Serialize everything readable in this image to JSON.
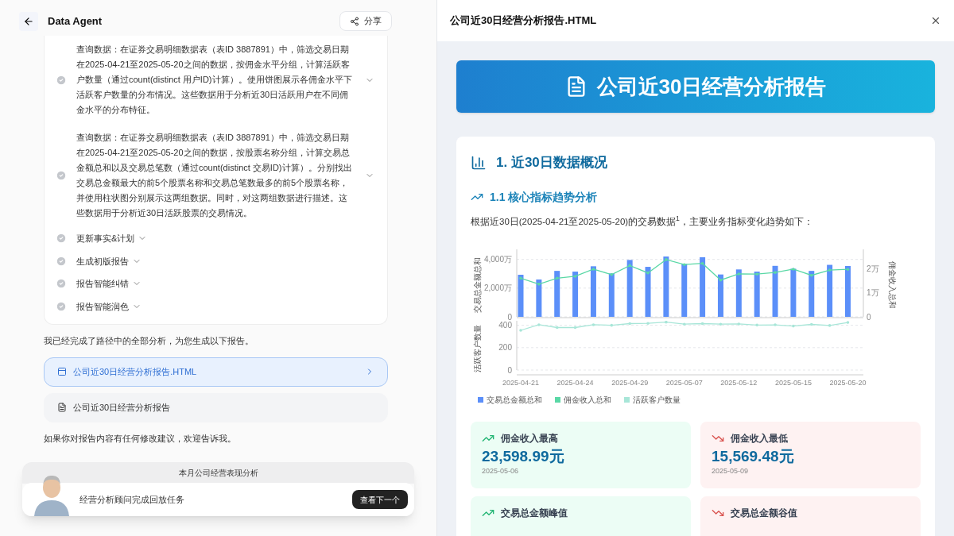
{
  "header": {
    "title": "Data Agent",
    "share": "分享"
  },
  "steps": [
    {
      "text": "查询数据：在证券交易明细数据表（表ID 3887891）中，筛选交易日期在2025-04-21至2025-05-20之间的数据，按佣金水平分组，计算活跃客户数量（通过count(distinct 用户ID)计算）。使用饼图展示各佣金水平下活跃客户数量的分布情况。这些数据用于分析近30日活跃用户在不同佣金水平的分布特征。",
      "kind": "long"
    },
    {
      "text": "查询数据：在证券交易明细数据表（表ID 3887891）中，筛选交易日期在2025-04-21至2025-05-20之间的数据，按股票名称分组，计算交易总金额总和以及交易总笔数（通过count(distinct 交易ID)计算）。分别找出交易总金额最大的前5个股票名称和交易总笔数最多的前5个股票名称，并使用柱状图分别展示这两组数据。同时，对这两组数据进行描述。这些数据用于分析近30日活跃股票的交易情况。",
      "kind": "long"
    },
    {
      "text": "更新事实&计划",
      "kind": "short"
    },
    {
      "text": "生成初版报告",
      "kind": "short"
    },
    {
      "text": "报告智能纠错",
      "kind": "short"
    },
    {
      "text": "报告智能润色",
      "kind": "short"
    }
  ],
  "done_message": "我已经完成了路径中的全部分析，为您生成以下报告。",
  "files": [
    {
      "name": "公司近30日经营分析报告.HTML",
      "kind": "html",
      "selected": true
    },
    {
      "name": "公司近30日经营分析报告",
      "kind": "doc",
      "selected": false
    }
  ],
  "followup": "如果你对报告内容有任何修改建议，欢迎告诉我。",
  "replay": {
    "title": "本月公司经营表现分析",
    "message": "经营分析顾问完成回放任务",
    "next": "查看下一个"
  },
  "preview": {
    "title": "公司近30日经营分析报告.HTML",
    "report": {
      "title": "公司近30日经营分析报告",
      "section": "1. 近30日数据概况",
      "subsection": "1.1 核心指标趋势分析",
      "intro": "根据近30日(2025-04-21至2025-05-20)的交易数据$^{1}$，主要业务指标变化趋势如下：",
      "chart_data": {
        "type": "bar",
        "ylim": [
          0,
          4700
        ],
        "yticks": [
          {
            "value": 0,
            "label": "0"
          },
          {
            "value": 2000,
            "label": "2,000万"
          },
          {
            "value": 4000,
            "label": "4,000万"
          }
        ],
        "ylabel": "交易总金额总和",
        "series": [
          {
            "name": "交易总金额总和",
            "color": "#5b8ff9",
            "values": [
              2930,
              2600,
              3200,
              3150,
              3520,
              3020,
              3960,
              3480,
              4200,
              3680,
              4150,
              2950,
              3300,
              3150,
              3550,
              3350,
              3200,
              3620,
              3540
            ]
          }
        ]
      },
      "commission_chart": {
        "chart_data": {
          "type": "line",
          "ylim": [
            0,
            2.83
          ],
          "yticks": [
            {
              "value": 0,
              "label": "0"
            },
            {
              "value": 1,
              "label": "1万"
            },
            {
              "value": 2,
              "label": "2万"
            }
          ],
          "ylabel": "佣金收入总和",
          "series": [
            {
              "name": "佣金收入总和",
              "color": "#5ad8a6",
              "values": [
                1.62,
                1.37,
                1.62,
                1.7,
                2.0,
                1.77,
                2.15,
                1.84,
                2.4,
                2.19,
                2.24,
                1.54,
                1.8,
                1.79,
                1.86,
                2.0,
                1.74,
                1.96,
                1.99
              ]
            }
          ]
        }
      },
      "customers_chart": {
        "chart_data": {
          "type": "line",
          "categories": [
            "2025-04-21",
            null,
            null,
            "2025-04-24",
            null,
            null,
            "2025-04-29",
            null,
            null,
            "2025-05-07",
            null,
            null,
            "2025-05-12",
            null,
            null,
            "2025-05-15",
            null,
            null,
            "2025-05-20"
          ],
          "ylim": [
            0,
            440
          ],
          "yticks": [
            0,
            200,
            400
          ],
          "ylabel": "活跃客户数量",
          "series": [
            {
              "name": "活跃客户数量",
              "color": "#a8e6d8",
              "values": [
                355,
                405,
                380,
                380,
                405,
                400,
                415,
                417,
                428,
                410,
                415,
                410,
                412,
                402,
                404,
                393,
                408,
                398,
                425
              ]
            }
          ]
        }
      },
      "stats": [
        {
          "label": "佣金收入最高",
          "value": "23,598.99元",
          "date": "2025-05-06",
          "kind": "up"
        },
        {
          "label": "佣金收入最低",
          "value": "15,569.48元",
          "date": "2025-05-09",
          "kind": "down"
        },
        {
          "label": "交易总金额峰值",
          "kind": "up"
        },
        {
          "label": "交易总金额谷值",
          "kind": "down"
        }
      ]
    }
  }
}
